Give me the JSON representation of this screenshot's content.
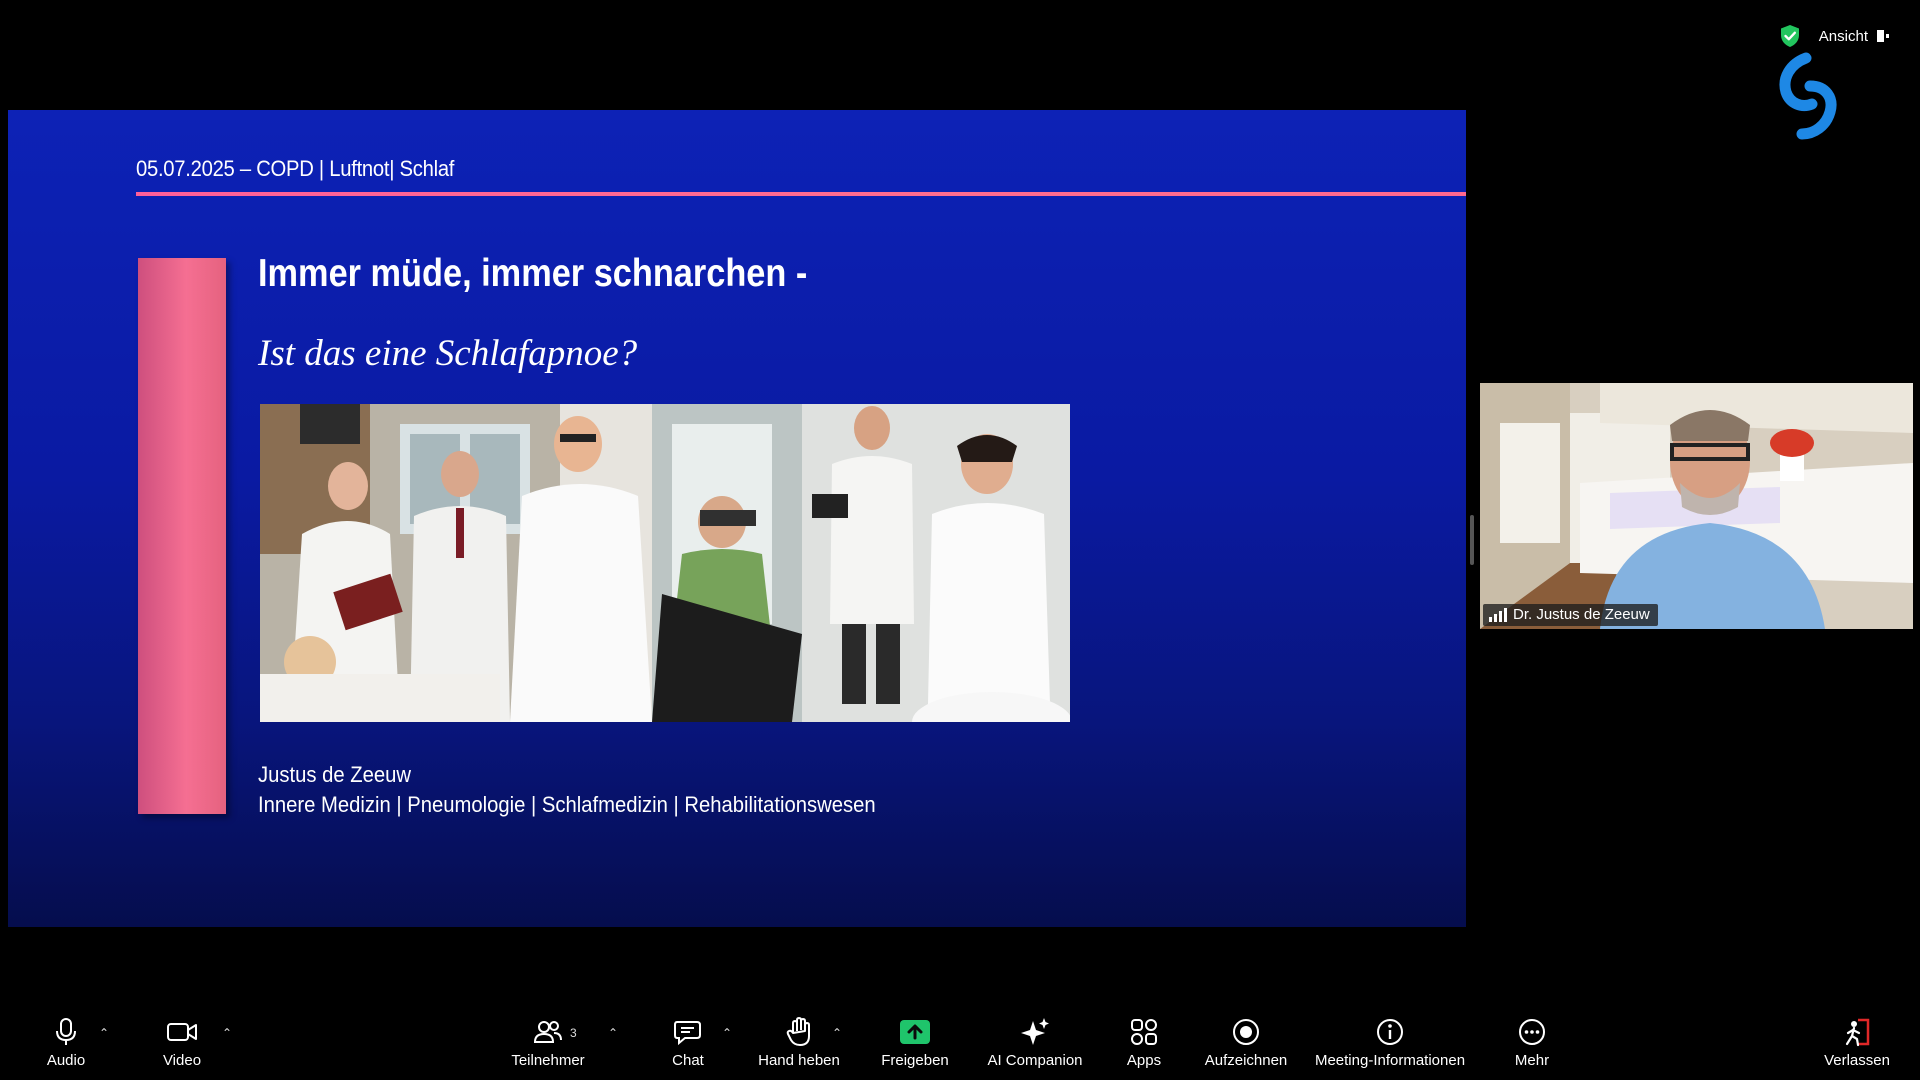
{
  "header": {
    "view_label": "Ansicht"
  },
  "slide": {
    "header_line": "05.07.2025 – COPD | Luftnot| Schlaf",
    "title": "Immer müde, immer schnarchen -",
    "subtitle": "Ist das eine Schlafapnoe?",
    "author": "Justus de Zeeuw",
    "specialties": "Innere Medizin | Pneumologie | Schlafmedizin | Rehabilitationswesen",
    "colors": {
      "background": "#0b1da8",
      "accent_pink": "#f06a8e"
    }
  },
  "participant": {
    "name": "Dr. Justus de Zeeuw",
    "signal_icon": "signal-bars-icon"
  },
  "toolbar": {
    "audio": {
      "label": "Audio",
      "icon": "microphone-icon"
    },
    "video": {
      "label": "Video",
      "icon": "camera-icon"
    },
    "participants": {
      "label": "Teilnehmer",
      "icon": "participants-icon",
      "count": "3"
    },
    "chat": {
      "label": "Chat",
      "icon": "chat-icon"
    },
    "raise_hand": {
      "label": "Hand heben",
      "icon": "hand-icon"
    },
    "share": {
      "label": "Freigeben",
      "icon": "share-screen-icon",
      "color": "#1fc46b"
    },
    "ai_companion": {
      "label": "AI Companion",
      "icon": "sparkle-icon"
    },
    "apps": {
      "label": "Apps",
      "icon": "apps-icon"
    },
    "record": {
      "label": "Aufzeichnen",
      "icon": "record-icon"
    },
    "meeting_info": {
      "label": "Meeting-Informationen",
      "icon": "info-icon"
    },
    "more": {
      "label": "Mehr",
      "icon": "more-icon"
    },
    "leave": {
      "label": "Verlassen",
      "icon": "leave-icon",
      "color": "#e02828"
    }
  }
}
